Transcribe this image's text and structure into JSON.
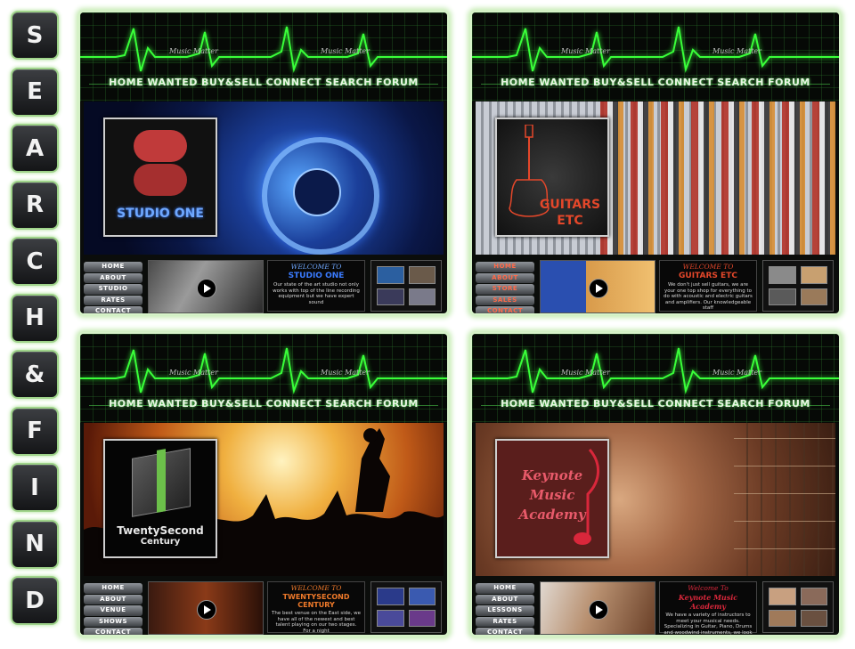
{
  "side_keys": [
    "S",
    "E",
    "A",
    "R",
    "C",
    "H",
    "&",
    "F",
    "I",
    "N",
    "D"
  ],
  "site_logo_text": "Music Matter",
  "nav": [
    "HOME",
    "WANTED",
    "BUY&SELL",
    "CONNECT",
    "SEARCH",
    "FORUM"
  ],
  "panels": [
    {
      "logo": "STUDIO ONE",
      "side_nav": [
        "HOME",
        "ABOUT",
        "STUDIO",
        "RATES",
        "CONTACT"
      ],
      "welcome_title": "WELCOME TO",
      "welcome_name": "STUDIO ONE",
      "welcome_text": "Our state of the art studio not only works with top of the line recording equipment but we have expert sound"
    },
    {
      "logo_line1": "GUITARS",
      "logo_line2": "ETC",
      "side_nav": [
        "HOME",
        "ABOUT",
        "STORE",
        "SALES",
        "CONTACT"
      ],
      "welcome_title": "WELCOME TO",
      "welcome_name": "GUITARS ETC",
      "welcome_text": "We don't just sell guitars, we are your one top shop for everything to do with acoustic and electric guitars and amplifiers. Our knowledgeable staff"
    },
    {
      "logo_line1": "TwentySecond",
      "logo_line2": "Century",
      "side_nav": [
        "HOME",
        "ABOUT",
        "VENUE",
        "SHOWS",
        "CONTACT"
      ],
      "welcome_title": "WELCOME TO",
      "welcome_name": "TWENTYSECOND CENTURY",
      "welcome_text": "The best venue on the East side, we have all of the newest and best talent playing on our two stages. For a night"
    },
    {
      "logo_line1": "Keynote",
      "logo_line2": "Music",
      "logo_line3": "Academy",
      "side_nav": [
        "HOME",
        "ABOUT",
        "LESSONS",
        "RATES",
        "CONTACT"
      ],
      "welcome_title": "Welcome To",
      "welcome_name": "Keynote Music Academy",
      "welcome_text": "We have a variety of instructors to meet your musical needs. Specializing in Guitar, Piano, Drums and woodwind instruments, we look to improve and"
    }
  ],
  "colors": {
    "pulse_green": "#39ff39",
    "key_border": "#9fd38a",
    "panel_glow": "#c7ecb5",
    "studio_blue": "#3a7bff",
    "guitars_red": "#e4472a",
    "century_orange": "#f07a2a",
    "keynote_red": "#d9273b"
  }
}
